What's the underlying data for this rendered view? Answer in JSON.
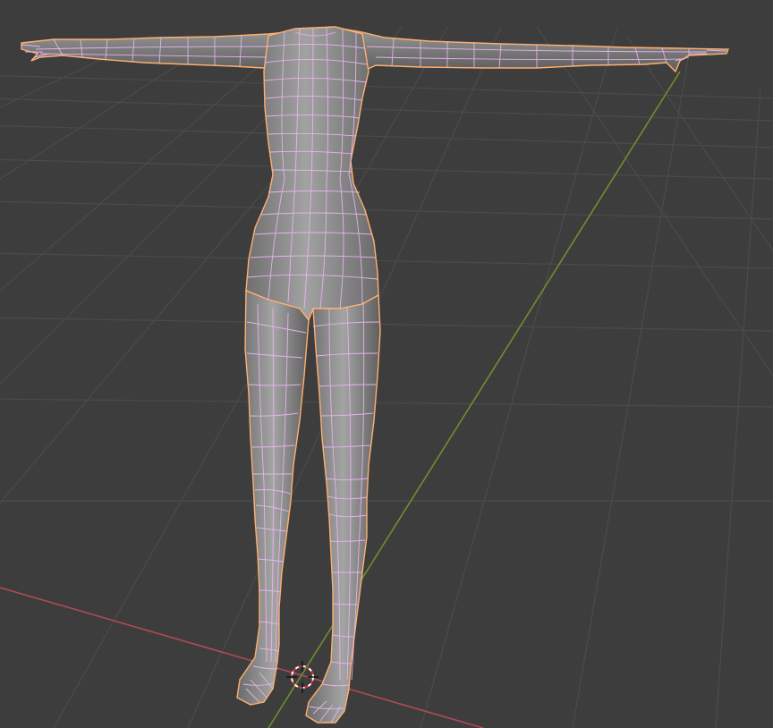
{
  "app": "3D viewport",
  "viewport": {
    "background": "#3d3d3d",
    "grid_color": "#4a4a4a",
    "x_axis_color": "#b04a55",
    "y_axis_color": "#6e8f2e"
  },
  "model": {
    "fill": "#8a8a8a",
    "wire_color": "#e9b6ef",
    "outline_color": "#ffb070"
  },
  "cursor": {
    "icon": "3d-cursor-icon",
    "color_a": "#e03030",
    "color_b": "#ffffff"
  }
}
